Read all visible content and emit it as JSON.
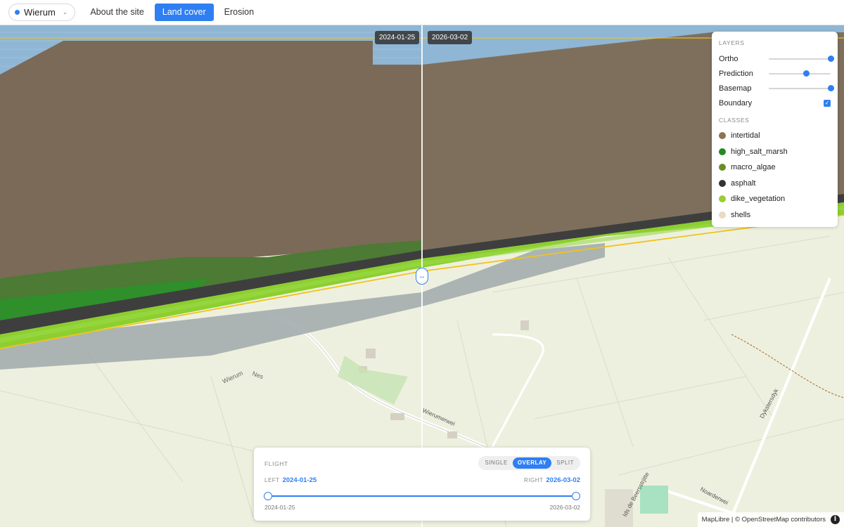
{
  "header": {
    "site_name": "Wierum",
    "tabs": [
      {
        "label": "About the site",
        "active": false
      },
      {
        "label": "Land cover",
        "active": true
      },
      {
        "label": "Erosion",
        "active": false
      }
    ],
    "accent_color": "#2f7ff2"
  },
  "map": {
    "left_date": "2024-01-25",
    "right_date": "2026-03-02",
    "place_labels": [
      "Wierum",
      "Nes",
      "Wierumerwei",
      "Dykstersdyk",
      "Noarderwei",
      "Ids de Beersstrjitte"
    ],
    "icons": [
      "swap-arrows-icon",
      "info-icon",
      "check-icon",
      "chevron-down-icon"
    ]
  },
  "layers_panel": {
    "heading": "LAYERS",
    "layers": [
      {
        "label": "Ortho",
        "control": "slider",
        "value": 1.0
      },
      {
        "label": "Prediction",
        "control": "slider",
        "value": 0.6
      },
      {
        "label": "Basemap",
        "control": "slider",
        "value": 1.0
      },
      {
        "label": "Boundary",
        "control": "checkbox",
        "checked": true
      }
    ],
    "classes_heading": "CLASSES",
    "classes": [
      {
        "label": "intertidal",
        "color": "#8b7355"
      },
      {
        "label": "high_salt_marsh",
        "color": "#228b22"
      },
      {
        "label": "macro_algae",
        "color": "#6b8e23"
      },
      {
        "label": "asphalt",
        "color": "#333333"
      },
      {
        "label": "dike_vegetation",
        "color": "#9acd32"
      },
      {
        "label": "shells",
        "color": "#e8dcc4"
      }
    ]
  },
  "flight_panel": {
    "heading": "FLIGHT",
    "modes": [
      {
        "label": "SINGLE",
        "active": false
      },
      {
        "label": "OVERLAY",
        "active": true
      },
      {
        "label": "SPLIT",
        "active": false
      }
    ],
    "left_label": "LEFT",
    "left_value": "2024-01-25",
    "right_label": "RIGHT",
    "right_value": "2026-03-02",
    "range_start": "2024-01-25",
    "range_end": "2026-03-02",
    "selected_start": 0.0,
    "selected_end": 1.0
  },
  "attribution": {
    "maplibre": "MapLibre",
    "separator": " | © ",
    "osm": "OpenStreetMap",
    "contributors": " contributors"
  }
}
